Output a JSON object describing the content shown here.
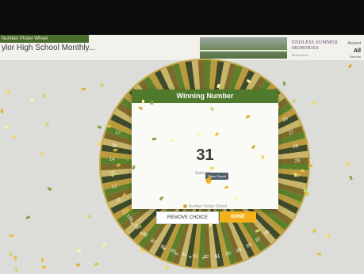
{
  "tab": {
    "label": "Number Picker Wheel"
  },
  "header": {
    "title": "ylor High School Monthly..."
  },
  "ad": {
    "headline_1": "ENDLESS SUMMER",
    "headline_2": "MEMORIES",
    "subtext": "Reservations",
    "brand_sig": "Ascend",
    "brand_big": "All",
    "brand_small": "Resorts"
  },
  "wheel": {
    "left_labels": [
      "17",
      "16",
      "14",
      "13",
      "12",
      "11",
      "10",
      "9",
      "8",
      "7",
      "6",
      "5",
      "4",
      "3",
      "2"
    ],
    "right_labels": [
      "25",
      "26",
      "27",
      "28",
      "29",
      "30"
    ],
    "bottom_labels": [
      "100",
      "99",
      "98",
      "97",
      "96",
      "95",
      "94",
      "93",
      "92",
      "91",
      "90",
      "89",
      "88",
      "87",
      "86"
    ],
    "colors": [
      "#5b7f2a",
      "#b99b3e",
      "#3f4a2a",
      "#c8b56a",
      "#7c6a2c"
    ]
  },
  "modal": {
    "title": "Winning Number",
    "number": "31",
    "selected_label": "Selected",
    "share_label": "Share Result",
    "brand_label": "Number Picker Wheel"
  },
  "buttons": {
    "remove": "REMOVE CHOICE",
    "done": "DONE"
  }
}
